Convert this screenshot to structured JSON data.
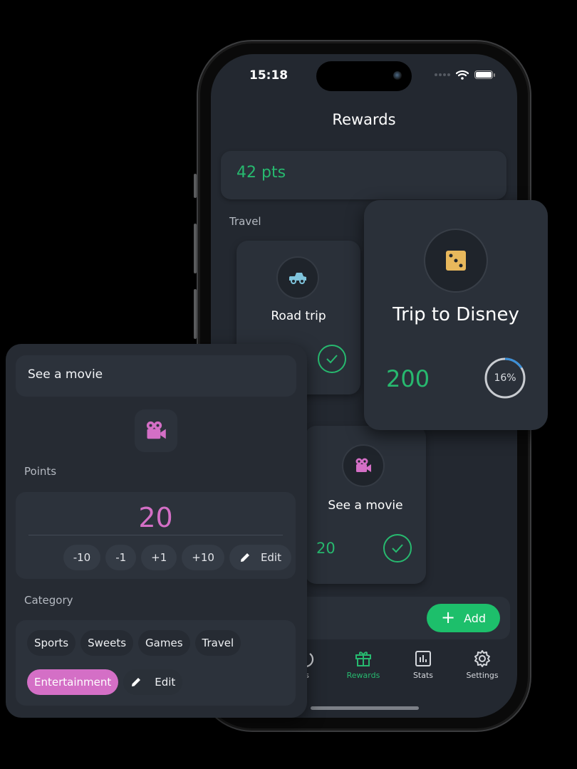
{
  "status_bar": {
    "time": "15:18"
  },
  "screen": {
    "title": "Rewards",
    "points_balance": "42 pts",
    "section_label": "Travel",
    "cards": [
      {
        "title": "Road trip",
        "icon": "truck-icon",
        "icon_color": "#7fc4dc",
        "completed": true
      },
      {
        "title": "See a movie",
        "icon": "movie-camera-icon",
        "icon_color": "#d46fc6",
        "points": "20",
        "completed": true
      }
    ],
    "add_button": {
      "label": "Add",
      "icon": "plus-icon"
    },
    "tabbar": [
      {
        "label": "ks",
        "icon": "tasks-icon",
        "active": false
      },
      {
        "label": "Rewards",
        "icon": "gift-icon",
        "active": true
      },
      {
        "label": "Stats",
        "icon": "chart-icon",
        "active": false
      },
      {
        "label": "Settings",
        "icon": "gear-icon",
        "active": false
      }
    ]
  },
  "featured_card": {
    "title": "Trip to Disney",
    "icon": "dice-icon",
    "icon_color": "#e8b85c",
    "points": "200",
    "progress_percent": 16,
    "progress_label": "16%"
  },
  "edit_panel": {
    "name_value": "See a movie",
    "icon": "movie-camera-icon",
    "points_label": "Points",
    "points_value": "20",
    "steppers": [
      "-10",
      "-1",
      "+1",
      "+10"
    ],
    "edit_label": "Edit",
    "category_label": "Category",
    "categories": [
      "Sports",
      "Sweets",
      "Games",
      "Travel",
      "Entertainment"
    ],
    "selected_category": "Entertainment",
    "category_edit_label": "Edit"
  },
  "colors": {
    "accent_green": "#27b96f",
    "accent_pink": "#d46fc6",
    "progress_blue": "#3b8fd8"
  }
}
